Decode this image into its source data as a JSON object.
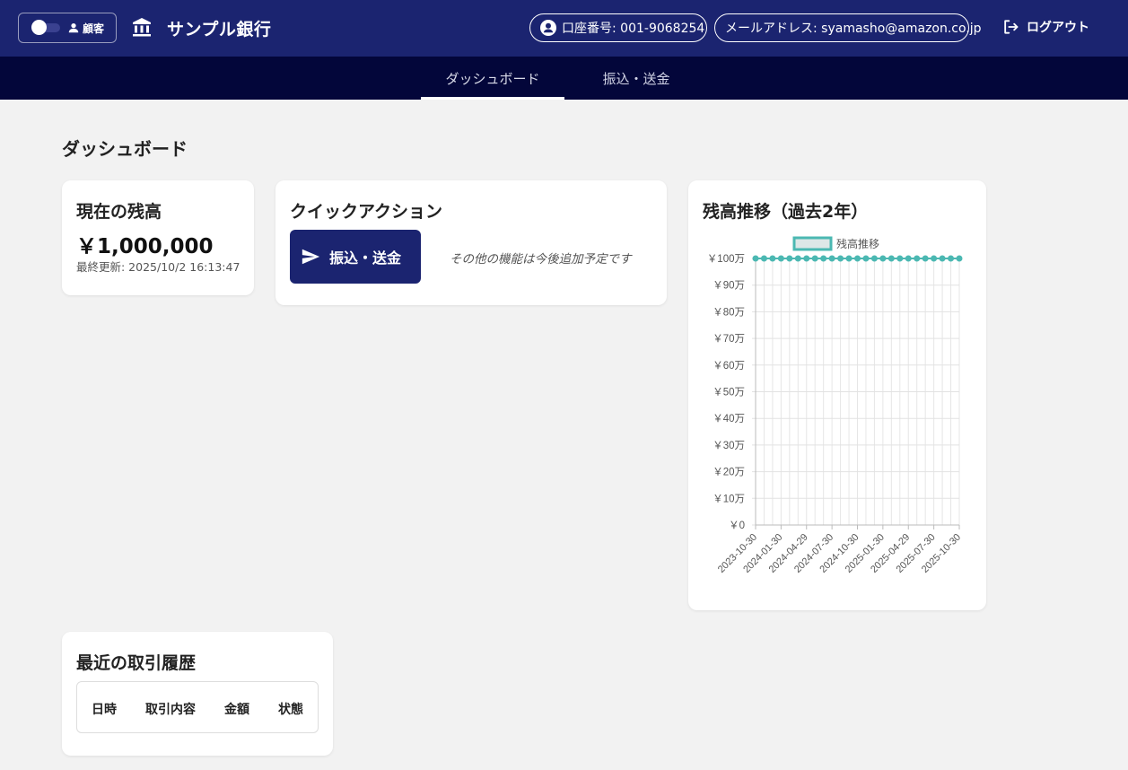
{
  "header": {
    "role_label": "顧客",
    "bank_name": "サンプル銀行",
    "account": "口座番号: 001-9068254",
    "email": "メールアドレス: syamasho@amazon.co.jp",
    "logout_label": "ログアウト"
  },
  "nav": {
    "tabs": [
      {
        "label": "ダッシュボード",
        "active": true
      },
      {
        "label": "振込・送金",
        "active": false
      }
    ]
  },
  "page_title": "ダッシュボード",
  "balance": {
    "title": "現在の残高",
    "amount": "￥1,000,000",
    "updated": "最終更新: 2025/10/2 16:13:47"
  },
  "quick_actions": {
    "title": "クイックアクション",
    "transfer_label": "振込・送金",
    "note": "その他の機能は今後追加予定です"
  },
  "chart": {
    "title": "残高推移（過去2年）"
  },
  "chart_data": {
    "type": "line",
    "legend": "残高推移",
    "y_ticks": [
      "￥0",
      "￥10万",
      "￥20万",
      "￥30万",
      "￥40万",
      "￥50万",
      "￥60万",
      "￥70万",
      "￥80万",
      "￥90万",
      "￥100万"
    ],
    "ylim": [
      0,
      1000000
    ],
    "x_ticks": [
      "2023-10-30",
      "2024-01-30",
      "2024-04-29",
      "2024-07-30",
      "2024-10-30",
      "2025-01-30",
      "2025-04-29",
      "2025-07-30",
      "2025-10-30"
    ],
    "series": [
      {
        "name": "残高推移",
        "values": [
          1000000,
          1000000,
          1000000,
          1000000,
          1000000,
          1000000,
          1000000,
          1000000,
          1000000,
          1000000,
          1000000,
          1000000,
          1000000,
          1000000,
          1000000,
          1000000,
          1000000,
          1000000,
          1000000,
          1000000,
          1000000,
          1000000,
          1000000,
          1000000,
          1000000
        ]
      }
    ],
    "colors": {
      "line": "#4bb8b2",
      "fill": "#dde7e7"
    },
    "grid": true
  },
  "history": {
    "title": "最近の取引履歴",
    "columns": [
      "日時",
      "取引内容",
      "金額",
      "状態"
    ]
  }
}
